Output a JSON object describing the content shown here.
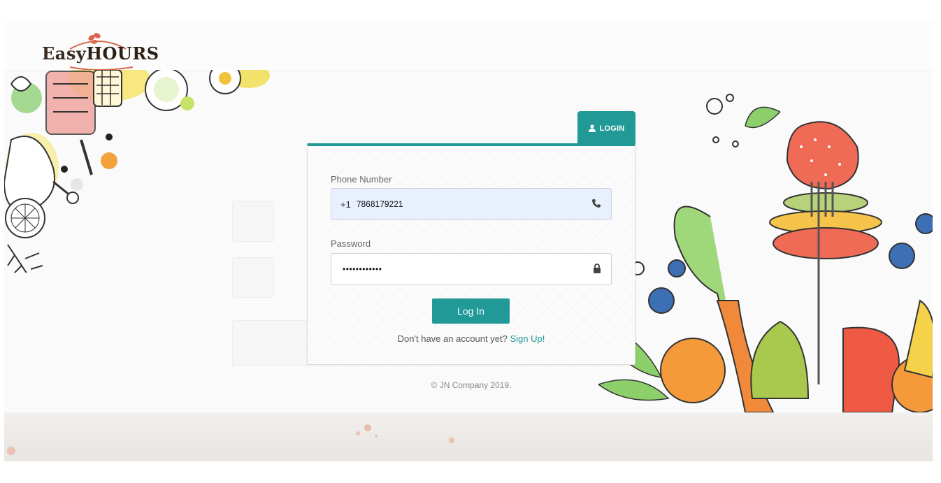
{
  "brand": {
    "name_part1": "Easy",
    "name_part2": "HOURS"
  },
  "login_tab": {
    "label": "LOGIN",
    "icon": "user-icon"
  },
  "form": {
    "phone_label": "Phone Number",
    "country_code": "+1",
    "phone_value": "7868179221",
    "phone_icon": "phone-icon",
    "password_label": "Password",
    "password_value": "••••••••••••",
    "password_icon": "lock-icon",
    "submit_label": "Log In",
    "signup_prompt": "Don't have an account yet?",
    "signup_link": "Sign Up!"
  },
  "footer": {
    "copyright": "© JN Company 2019."
  },
  "colors": {
    "accent": "#219a97",
    "autofill_bg": "#e8f0fe",
    "logo_leaf": "#d9674f"
  }
}
